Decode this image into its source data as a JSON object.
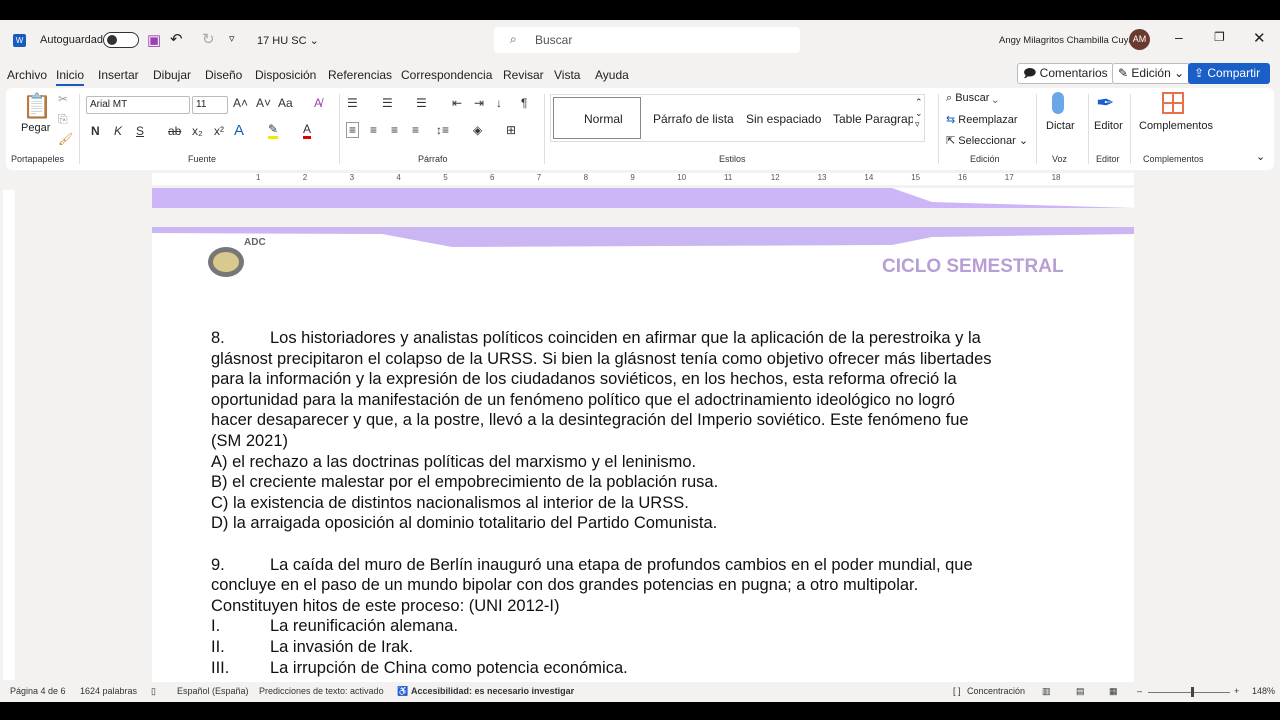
{
  "titlebar": {
    "app_icon": "word-icon",
    "autosave_label": "Autoguardado",
    "doc_name": "17 HU SC",
    "search_placeholder": "Buscar",
    "user_name": "Angy Milagritos Chambilla Cuya",
    "user_initials": "AM"
  },
  "menu": [
    "Archivo",
    "Inicio",
    "Insertar",
    "Dibujar",
    "Diseño",
    "Disposición",
    "Referencias",
    "Correspondencia",
    "Revisar",
    "Vista",
    "Ayuda"
  ],
  "actions": {
    "comments": "Comentarios",
    "editing": "Edición",
    "share": "Compartir"
  },
  "ribbon": {
    "paste": "Pegar",
    "clipboard_group": "Portapapeles",
    "font_name": "Arial MT",
    "font_size": "11",
    "font_group": "Fuente",
    "bold": "N",
    "italic": "K",
    "underline": "S",
    "case": "Aa",
    "paragraph_group": "Párrafo",
    "styles": [
      "Normal",
      "Párrafo de lista",
      "Sin espaciado",
      "Table Paragrap"
    ],
    "styles_group": "Estilos",
    "find": "Buscar",
    "replace": "Reemplazar",
    "select": "Seleccionar",
    "editing_group": "Edición",
    "dictate": "Dictar",
    "voice_group": "Voz",
    "editor": "Editor",
    "editor_group": "Editor",
    "addins": "Complementos",
    "addins_group": "Complementos"
  },
  "ruler_numbers": [
    "1",
    "2",
    "3",
    "4",
    "5",
    "6",
    "7",
    "8",
    "9",
    "10",
    "11",
    "12",
    "13",
    "14",
    "15",
    "16",
    "17",
    "18"
  ],
  "header": {
    "logo_text": "ADC",
    "title": "CICLO SEMESTRAL",
    "accent": "#c9b6f3"
  },
  "document": {
    "q8": {
      "number": "8.",
      "lines": [
        "Los historiadores y analistas políticos coinciden en afirmar que la aplicación de la perestroika y la",
        "glásnost precipitaron el colapso de la URSS. Si bien la glásnost tenía como objetivo ofrecer más libertades",
        "para la información y la expresión de los ciudadanos soviéticos, en los hechos, esta reforma ofreció la",
        "oportunidad para la manifestación de un fenómeno político que el adoctrinamiento ideológico no logró",
        "hacer desaparecer y que, a la postre, llevó a la desintegración del Imperio soviético. Este fenómeno fue",
        "(SM 2021)"
      ],
      "options": [
        "A) el rechazo a las doctrinas políticas del marxismo y el leninismo.",
        "B) el creciente malestar por el empobrecimiento de la población rusa.",
        "C) la existencia de distintos nacionalismos al interior de la URSS.",
        "D) la arraigada oposición al dominio totalitario del Partido Comunista."
      ]
    },
    "q9": {
      "number": "9.",
      "lines": [
        "La caída del muro de Berlín inauguró una etapa de profundos cambios en el poder mundial, que",
        "concluye en el paso de un mundo bipolar con dos grandes potencias en pugna; a otro multipolar.",
        "Constituyen hitos de este proceso: (UNI 2012-I)"
      ],
      "items": [
        {
          "n": "I.",
          "t": "La reunificación alemana."
        },
        {
          "n": "II.",
          "t": "La invasión de Irak."
        },
        {
          "n": "III.",
          "t": "La irrupción de China como potencia económica."
        }
      ]
    }
  },
  "status": {
    "page": "Página 4 de 6",
    "words": "1624 palabras",
    "language": "Español (España)",
    "predictions": "Predicciones de texto: activado",
    "accessibility": "Accesibilidad: es necesario investigar",
    "focus": "Concentración",
    "zoom": "148%"
  }
}
